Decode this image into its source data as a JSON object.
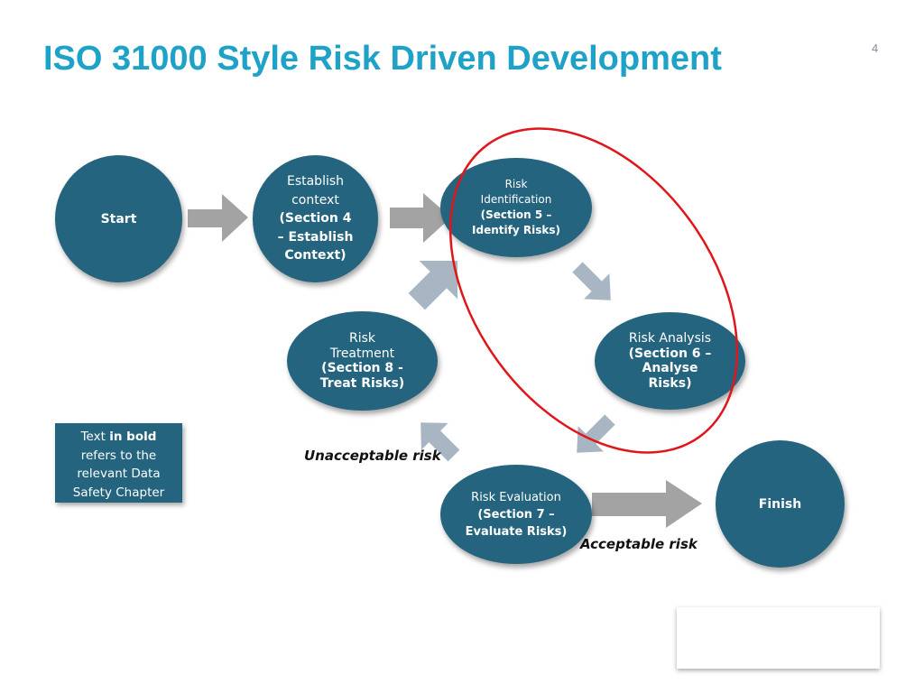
{
  "slide": {
    "title": "ISO 31000 Style Risk Driven Development",
    "page_number": "4"
  },
  "nodes": {
    "start": {
      "text": "Start"
    },
    "establish": {
      "line1": "Establish",
      "line2": "context",
      "bold1": "(Section 4",
      "bold2": "– Establish",
      "bold3": "Context)"
    },
    "identification": {
      "line1": "Risk",
      "line2": "Identification",
      "bold1": "(Section 5 –",
      "bold2": "Identify Risks)"
    },
    "analysis": {
      "line1": "Risk Analysis",
      "bold1": "(Section 6 –",
      "bold2": "Analyse",
      "bold3": "Risks)"
    },
    "evaluation": {
      "line1": "Risk Evaluation",
      "bold1": "(Section 7 –",
      "bold2": "Evaluate Risks)"
    },
    "treatment": {
      "line1": "Risk",
      "line2": "Treatment",
      "bold1": "(Section 8 -",
      "bold2": "Treat Risks)"
    },
    "finish": {
      "text": "Finish"
    }
  },
  "labels": {
    "unacceptable": "Unacceptable risk",
    "acceptable": "Acceptable risk"
  },
  "note": {
    "part1": "Text ",
    "bold": "in bold",
    "line2": "refers to the",
    "line3": "relevant Data",
    "line4": "Safety Chapter"
  },
  "colors": {
    "title": "#1FA2C8",
    "node_fill": "#24647F",
    "arrow_gray": "#A3A3A3",
    "arrow_blue_gray": "#A7B6C2",
    "highlight_ellipse": "#E0161B"
  }
}
